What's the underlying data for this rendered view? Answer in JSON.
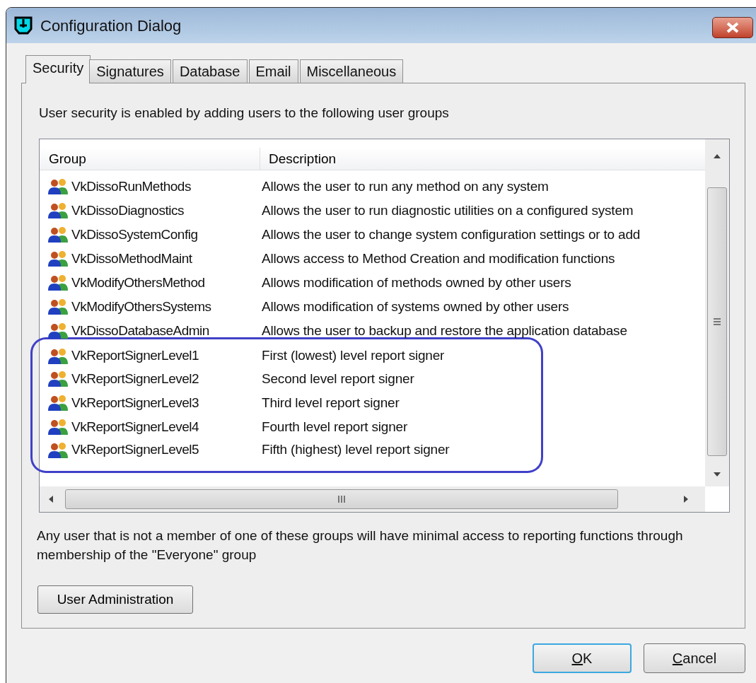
{
  "window": {
    "title": "Configuration Dialog"
  },
  "tabs": [
    {
      "label": "Security",
      "selected": true
    },
    {
      "label": "Signatures",
      "selected": false
    },
    {
      "label": "Database",
      "selected": false
    },
    {
      "label": "Email",
      "selected": false
    },
    {
      "label": "Miscellaneous",
      "selected": false
    }
  ],
  "intro": "User security is enabled by adding users to the following user groups",
  "table": {
    "columns": [
      "Group",
      "Description"
    ],
    "rows": [
      {
        "group": "VkDissoRunMethods",
        "description": "Allows the user to run any method on any system",
        "highlighted": false
      },
      {
        "group": "VkDissoDiagnostics",
        "description": "Allows the user to run diagnostic utilities on a configured system",
        "highlighted": false
      },
      {
        "group": "VkDissoSystemConfig",
        "description": "Allows the user to change system configuration settings or to add",
        "highlighted": false
      },
      {
        "group": "VkDissoMethodMaint",
        "description": "Allows access to Method Creation and modification functions",
        "highlighted": false
      },
      {
        "group": "VkModifyOthersMethod",
        "description": "Allows modification of methods owned by other users",
        "highlighted": false
      },
      {
        "group": "VkModifyOthersSystems",
        "description": "Allows modification of systems owned by other users",
        "highlighted": false
      },
      {
        "group": "VkDissoDatabaseAdmin",
        "description": "Allows the user to backup and restore the application database",
        "highlighted": false
      },
      {
        "group": "VkReportSignerLevel1",
        "description": "First (lowest) level report signer",
        "highlighted": true
      },
      {
        "group": "VkReportSignerLevel2",
        "description": "Second level report signer",
        "highlighted": true
      },
      {
        "group": "VkReportSignerLevel3",
        "description": "Third level report signer",
        "highlighted": true
      },
      {
        "group": "VkReportSignerLevel4",
        "description": "Fourth level report signer",
        "highlighted": true
      },
      {
        "group": "VkReportSignerLevel5",
        "description": "Fifth (highest) level report signer",
        "highlighted": true
      }
    ]
  },
  "note": "Any user that is not a member of one of these groups will have minimal access to reporting functions through membership of the \"Everyone\" group",
  "admin_button": "User Administration",
  "buttons": [
    {
      "label": "OK",
      "default": true
    },
    {
      "label": "Cancel",
      "default": false
    }
  ]
}
